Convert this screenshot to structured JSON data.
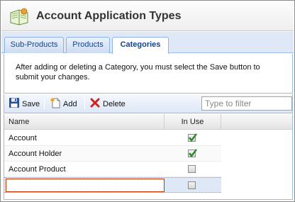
{
  "window": {
    "title": "Account Application Types"
  },
  "tabs": [
    {
      "label": "Sub-Products",
      "active": false
    },
    {
      "label": "Products",
      "active": false
    },
    {
      "label": "Categories",
      "active": true
    }
  ],
  "info": {
    "text": "After adding or deleting a Category, you must select the Save button to submit your changes."
  },
  "toolbar": {
    "save_label": "Save",
    "add_label": "Add",
    "delete_label": "Delete",
    "filter_placeholder": "Type to filter",
    "filter_value": ""
  },
  "grid": {
    "columns": [
      "Name",
      "In Use"
    ],
    "rows": [
      {
        "name": "Account",
        "in_use": true
      },
      {
        "name": "Account Holder",
        "in_use": true
      },
      {
        "name": "Account Product",
        "in_use": false
      },
      {
        "name": "",
        "in_use": false,
        "editing": true
      }
    ]
  },
  "colors": {
    "tab_text": "#15428b",
    "check_green": "#2b8a2b",
    "delete_red": "#cc2222",
    "save_blue": "#2a4f9c"
  },
  "icons": {
    "app": "book-icon",
    "save": "floppy-disk-icon",
    "add": "add-document-icon",
    "delete": "red-x-icon",
    "check": "checkmark-icon"
  }
}
